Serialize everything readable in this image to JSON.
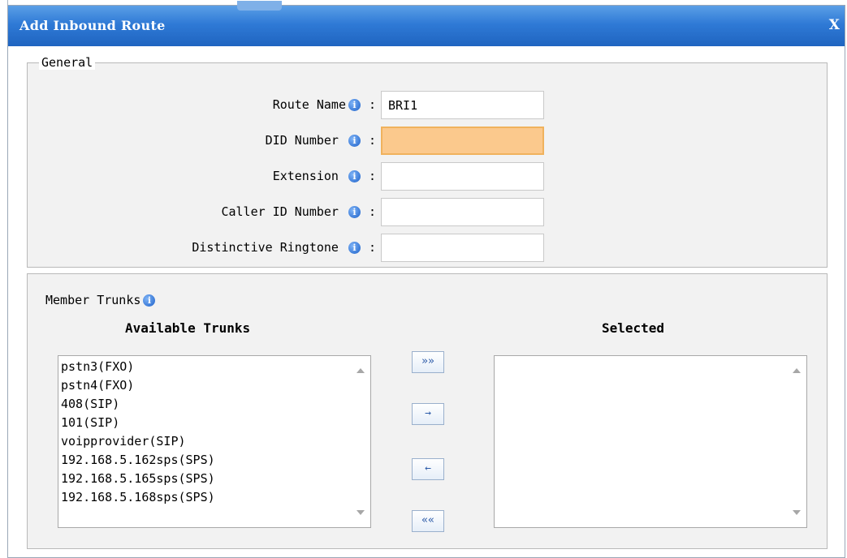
{
  "dialog": {
    "title": "Add Inbound Route",
    "close_label": "X"
  },
  "general": {
    "legend": "General",
    "fields": [
      {
        "label": "Route Name",
        "value": "BRI1"
      },
      {
        "label": "DID Number",
        "value": ""
      },
      {
        "label": "Extension",
        "value": ""
      },
      {
        "label": "Caller ID Number",
        "value": ""
      },
      {
        "label": "Distinctive Ringtone",
        "value": ""
      }
    ],
    "colon": ":"
  },
  "member_trunks": {
    "label": "Member Trunks",
    "available_heading": "Available Trunks",
    "selected_heading": "Selected",
    "available": [
      "pstn3(FXO)",
      "pstn4(FXO)",
      "408(SIP)",
      "101(SIP)",
      "voipprovider(SIP)",
      "192.168.5.162sps(SPS)",
      "192.168.5.165sps(SPS)",
      "192.168.5.168sps(SPS)"
    ],
    "selected": [],
    "buttons": {
      "add_all": "»»",
      "add_one": "→",
      "remove_one": "←",
      "remove_all": "««"
    }
  },
  "icons": {
    "info": "i"
  },
  "colors": {
    "titlebar": "#2f7ad6",
    "focused_field": "#fbc98d"
  }
}
